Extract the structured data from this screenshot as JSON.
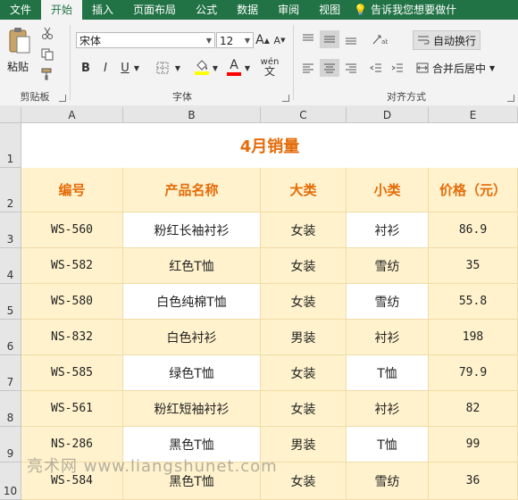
{
  "menu": {
    "tabs": [
      "文件",
      "开始",
      "插入",
      "页面布局",
      "公式",
      "数据",
      "审阅",
      "视图"
    ],
    "active": "开始",
    "tellme": "告诉我您想要做什"
  },
  "ribbon": {
    "clipboard": {
      "paste_label": "粘贴",
      "group_label": "剪贴板"
    },
    "font": {
      "font_name": "宋体",
      "font_size": "12",
      "bold": "B",
      "italic": "I",
      "underline": "U",
      "grow": "A",
      "shrink": "A",
      "font_color_letter": "A",
      "phonetic": "wén",
      "group_label": "字体",
      "fill_color": "#ffff00",
      "font_color": "#ff0000"
    },
    "alignment": {
      "wrap_text": "自动换行",
      "merge_center": "合并后居中",
      "group_label": "对齐方式"
    }
  },
  "sheet": {
    "columns": [
      "A",
      "B",
      "C",
      "D",
      "E"
    ],
    "rows": [
      "1",
      "2",
      "3",
      "4",
      "5",
      "6",
      "7",
      "8",
      "9",
      "10"
    ],
    "title": "4月销量",
    "headers": [
      "编号",
      "产品名称",
      "大类",
      "小类",
      "价格（元）"
    ],
    "data": [
      [
        "WS-560",
        "粉红长袖衬衫",
        "女装",
        "衬衫",
        "86.9"
      ],
      [
        "WS-582",
        "红色T恤",
        "女装",
        "雪纺",
        "35"
      ],
      [
        "WS-580",
        "白色纯棉T恤",
        "女装",
        "雪纺",
        "55.8"
      ],
      [
        "NS-832",
        "白色衬衫",
        "男装",
        "衬衫",
        "198"
      ],
      [
        "WS-585",
        "绿色T恤",
        "女装",
        "T恤",
        "79.9"
      ],
      [
        "WS-561",
        "粉红短袖衬衫",
        "女装",
        "衬衫",
        "82"
      ],
      [
        "NS-286",
        "黑色T恤",
        "男装",
        "T恤",
        "99"
      ],
      [
        "WS-584",
        "黑色T恤",
        "女装",
        "雪纺",
        "36"
      ]
    ],
    "colors": {
      "header_text": "#e46c0a",
      "band": "#fff2cc",
      "white": "#ffffff"
    }
  },
  "watermark": "亮术网 www.liangshunet.com"
}
